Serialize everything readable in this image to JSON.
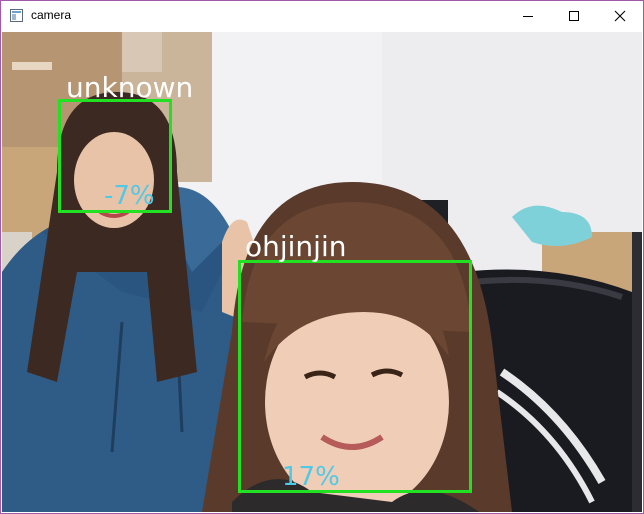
{
  "window": {
    "title": "camera",
    "controls": [
      "minimize-icon",
      "maximize-icon",
      "close-icon"
    ]
  },
  "detections": [
    {
      "name": "unknown",
      "confidence": "-7%"
    },
    {
      "name": "ohjinjin",
      "confidence": "17%"
    }
  ],
  "colors": {
    "box": "#22e122",
    "name_text": "#ffffff",
    "confidence_text": "#4fc9e6",
    "window_border": "#a05aa8"
  }
}
